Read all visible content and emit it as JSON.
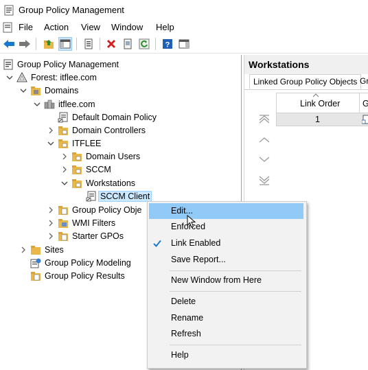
{
  "window": {
    "title": "Group Policy Management"
  },
  "menu": {
    "items": [
      "File",
      "Action",
      "View",
      "Window",
      "Help"
    ]
  },
  "toolbar": {
    "buttons": [
      "back-icon",
      "forward-icon",
      "up-folder-icon",
      "show-hide-tree-icon",
      "properties-icon",
      "delete-icon",
      "export-icon",
      "refresh-icon",
      "help-icon",
      "show-action-pane-icon"
    ]
  },
  "tree": {
    "root": "Group Policy Management",
    "forest": "Forest: itflee.com",
    "domains": "Domains",
    "domain": "itflee.com",
    "default_policy": "Default Domain Policy",
    "domain_controllers": "Domain Controllers",
    "itflee_ou": "ITFLEE",
    "domain_users": "Domain Users",
    "sccm": "SCCM",
    "workstations": "Workstations",
    "sccm_client": "SCCM Client",
    "gpo_objects": "Group Policy Obje",
    "wmi_filters": "WMI Filters",
    "starter_gpos": "Starter GPOs",
    "sites": "Sites",
    "modeling": "Group Policy Modeling",
    "results": "Group Policy Results"
  },
  "right_pane": {
    "title": "Workstations",
    "tabs": [
      "Linked Group Policy Objects",
      "Gr"
    ],
    "columns": [
      "Link Order",
      "G"
    ],
    "rows": [
      {
        "link_order": "1"
      }
    ]
  },
  "context_menu": {
    "edit": "Edit...",
    "enforced": "Enforced",
    "link_enabled": "Link Enabled",
    "link_enabled_checked": true,
    "save_report": "Save Report...",
    "new_window": "New Window from Here",
    "delete": "Delete",
    "rename": "Rename",
    "refresh": "Refresh",
    "help": "Help"
  },
  "colors": {
    "accent": "#1979ca",
    "hover": "#91c9f7",
    "selection": "#cce8ff"
  }
}
